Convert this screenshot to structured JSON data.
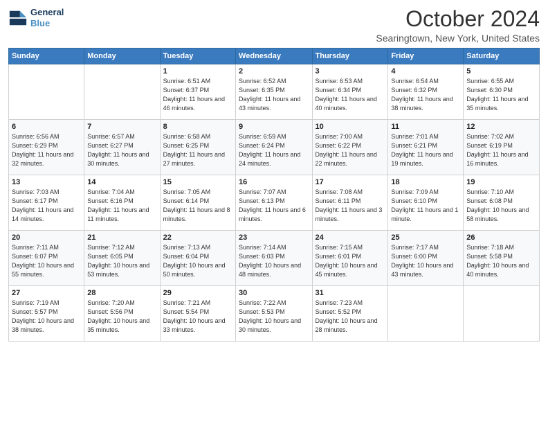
{
  "header": {
    "logo_line1": "General",
    "logo_line2": "Blue",
    "month": "October 2024",
    "location": "Searingtown, New York, United States"
  },
  "weekdays": [
    "Sunday",
    "Monday",
    "Tuesday",
    "Wednesday",
    "Thursday",
    "Friday",
    "Saturday"
  ],
  "weeks": [
    [
      {
        "day": "",
        "info": ""
      },
      {
        "day": "",
        "info": ""
      },
      {
        "day": "1",
        "info": "Sunrise: 6:51 AM\nSunset: 6:37 PM\nDaylight: 11 hours and 46 minutes."
      },
      {
        "day": "2",
        "info": "Sunrise: 6:52 AM\nSunset: 6:35 PM\nDaylight: 11 hours and 43 minutes."
      },
      {
        "day": "3",
        "info": "Sunrise: 6:53 AM\nSunset: 6:34 PM\nDaylight: 11 hours and 40 minutes."
      },
      {
        "day": "4",
        "info": "Sunrise: 6:54 AM\nSunset: 6:32 PM\nDaylight: 11 hours and 38 minutes."
      },
      {
        "day": "5",
        "info": "Sunrise: 6:55 AM\nSunset: 6:30 PM\nDaylight: 11 hours and 35 minutes."
      }
    ],
    [
      {
        "day": "6",
        "info": "Sunrise: 6:56 AM\nSunset: 6:29 PM\nDaylight: 11 hours and 32 minutes."
      },
      {
        "day": "7",
        "info": "Sunrise: 6:57 AM\nSunset: 6:27 PM\nDaylight: 11 hours and 30 minutes."
      },
      {
        "day": "8",
        "info": "Sunrise: 6:58 AM\nSunset: 6:25 PM\nDaylight: 11 hours and 27 minutes."
      },
      {
        "day": "9",
        "info": "Sunrise: 6:59 AM\nSunset: 6:24 PM\nDaylight: 11 hours and 24 minutes."
      },
      {
        "day": "10",
        "info": "Sunrise: 7:00 AM\nSunset: 6:22 PM\nDaylight: 11 hours and 22 minutes."
      },
      {
        "day": "11",
        "info": "Sunrise: 7:01 AM\nSunset: 6:21 PM\nDaylight: 11 hours and 19 minutes."
      },
      {
        "day": "12",
        "info": "Sunrise: 7:02 AM\nSunset: 6:19 PM\nDaylight: 11 hours and 16 minutes."
      }
    ],
    [
      {
        "day": "13",
        "info": "Sunrise: 7:03 AM\nSunset: 6:17 PM\nDaylight: 11 hours and 14 minutes."
      },
      {
        "day": "14",
        "info": "Sunrise: 7:04 AM\nSunset: 6:16 PM\nDaylight: 11 hours and 11 minutes."
      },
      {
        "day": "15",
        "info": "Sunrise: 7:05 AM\nSunset: 6:14 PM\nDaylight: 11 hours and 8 minutes."
      },
      {
        "day": "16",
        "info": "Sunrise: 7:07 AM\nSunset: 6:13 PM\nDaylight: 11 hours and 6 minutes."
      },
      {
        "day": "17",
        "info": "Sunrise: 7:08 AM\nSunset: 6:11 PM\nDaylight: 11 hours and 3 minutes."
      },
      {
        "day": "18",
        "info": "Sunrise: 7:09 AM\nSunset: 6:10 PM\nDaylight: 11 hours and 1 minute."
      },
      {
        "day": "19",
        "info": "Sunrise: 7:10 AM\nSunset: 6:08 PM\nDaylight: 10 hours and 58 minutes."
      }
    ],
    [
      {
        "day": "20",
        "info": "Sunrise: 7:11 AM\nSunset: 6:07 PM\nDaylight: 10 hours and 55 minutes."
      },
      {
        "day": "21",
        "info": "Sunrise: 7:12 AM\nSunset: 6:05 PM\nDaylight: 10 hours and 53 minutes."
      },
      {
        "day": "22",
        "info": "Sunrise: 7:13 AM\nSunset: 6:04 PM\nDaylight: 10 hours and 50 minutes."
      },
      {
        "day": "23",
        "info": "Sunrise: 7:14 AM\nSunset: 6:03 PM\nDaylight: 10 hours and 48 minutes."
      },
      {
        "day": "24",
        "info": "Sunrise: 7:15 AM\nSunset: 6:01 PM\nDaylight: 10 hours and 45 minutes."
      },
      {
        "day": "25",
        "info": "Sunrise: 7:17 AM\nSunset: 6:00 PM\nDaylight: 10 hours and 43 minutes."
      },
      {
        "day": "26",
        "info": "Sunrise: 7:18 AM\nSunset: 5:58 PM\nDaylight: 10 hours and 40 minutes."
      }
    ],
    [
      {
        "day": "27",
        "info": "Sunrise: 7:19 AM\nSunset: 5:57 PM\nDaylight: 10 hours and 38 minutes."
      },
      {
        "day": "28",
        "info": "Sunrise: 7:20 AM\nSunset: 5:56 PM\nDaylight: 10 hours and 35 minutes."
      },
      {
        "day": "29",
        "info": "Sunrise: 7:21 AM\nSunset: 5:54 PM\nDaylight: 10 hours and 33 minutes."
      },
      {
        "day": "30",
        "info": "Sunrise: 7:22 AM\nSunset: 5:53 PM\nDaylight: 10 hours and 30 minutes."
      },
      {
        "day": "31",
        "info": "Sunrise: 7:23 AM\nSunset: 5:52 PM\nDaylight: 10 hours and 28 minutes."
      },
      {
        "day": "",
        "info": ""
      },
      {
        "day": "",
        "info": ""
      }
    ]
  ]
}
